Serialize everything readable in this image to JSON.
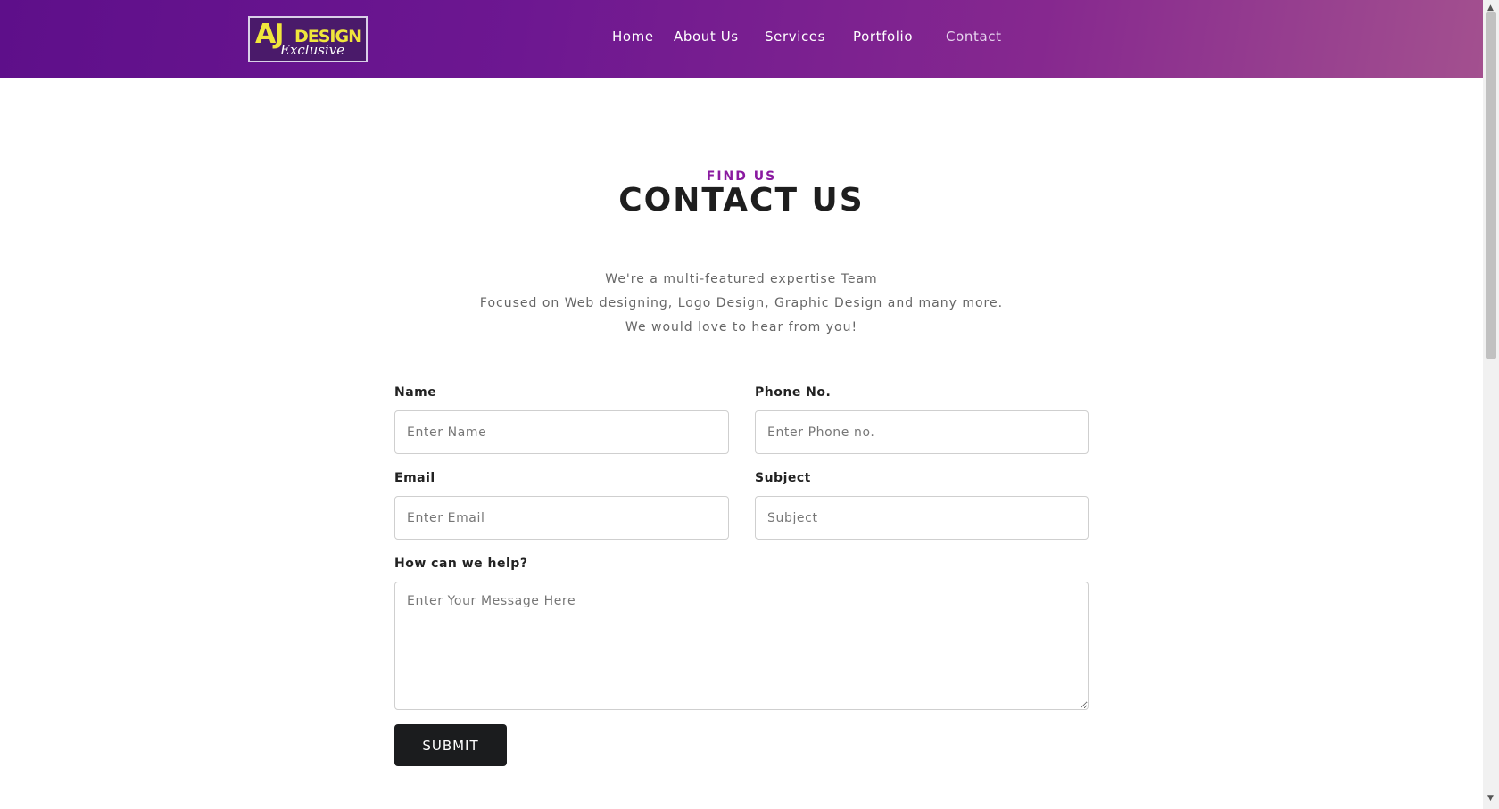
{
  "brand": {
    "logo_main": "AJ",
    "logo_design": "DESIGN",
    "logo_sub": "Exclusive",
    "colors": {
      "nav_start": "#5e0f8a",
      "nav_end": "#a3508f",
      "logo_yellow": "#f0e63c",
      "eyebrow": "#8a1aa0"
    }
  },
  "nav": {
    "items": [
      {
        "label": "Home"
      },
      {
        "label": "About Us"
      },
      {
        "label": "Services"
      },
      {
        "label": "Portfolio"
      },
      {
        "label": "Contact",
        "active": true
      }
    ]
  },
  "hero": {
    "eyebrow": "FIND US",
    "title": "CONTACT US",
    "lines": [
      "We're a multi-featured expertise Team",
      "Focused on Web designing, Logo Design, Graphic Design and many more.",
      "We would love to hear from you!"
    ]
  },
  "form": {
    "name": {
      "label": "Name",
      "placeholder": "Enter Name",
      "value": ""
    },
    "phone": {
      "label": "Phone No.",
      "placeholder": "Enter Phone no.",
      "value": ""
    },
    "email": {
      "label": "Email",
      "placeholder": "Enter Email",
      "value": ""
    },
    "subject": {
      "label": "Subject",
      "placeholder": "Subject",
      "value": ""
    },
    "message": {
      "label": "How can we help?",
      "placeholder": "Enter Your Message Here",
      "value": ""
    },
    "submit_label": "SUBMIT"
  }
}
